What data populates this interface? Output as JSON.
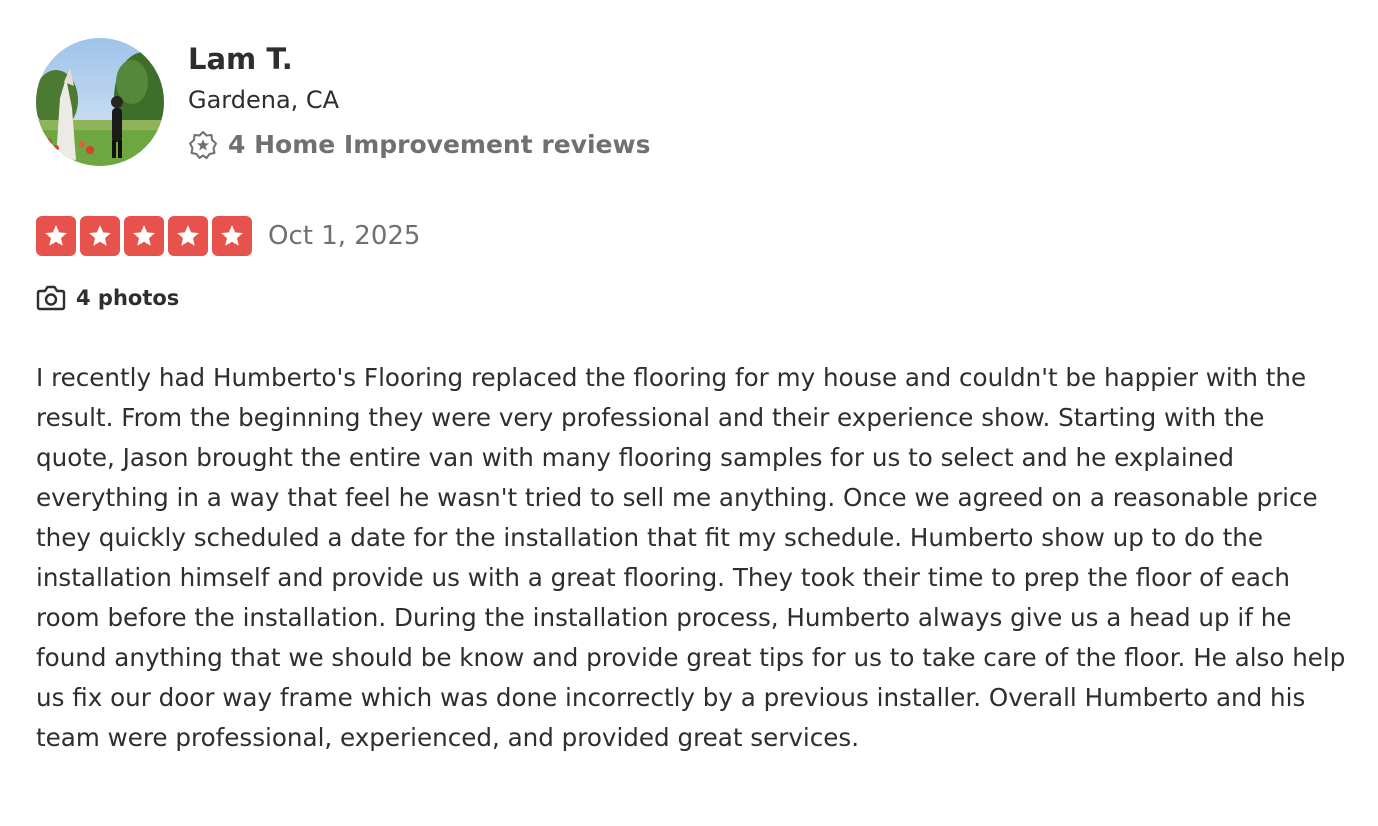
{
  "reviewer": {
    "name": "Lam T.",
    "location": "Gardena, CA",
    "review_count_label": "4 Home Improvement reviews",
    "avatar_icon": "user-photo-avatar"
  },
  "rating": {
    "stars": 5,
    "max_stars": 5,
    "star_color": "#e8524c",
    "date": "Oct 1, 2025"
  },
  "photos": {
    "label": "4 photos",
    "icon": "camera-icon"
  },
  "review": {
    "text": "I recently had Humberto's Flooring replaced the flooring for my house and couldn't be happier with the result. From the beginning they were very professional and their experience show. Starting with the quote, Jason brought the entire van with many flooring samples for us to select and he explained everything in a way that feel he wasn't tried to sell me anything. Once we agreed on a reasonable price they quickly scheduled a date for the installation that fit my schedule. Humberto show up to do the installation himself and provide us with a great flooring. They took their time to prep the floor of each room before the installation. During the installation process, Humberto always give us a head up if he found anything that we should be know and provide great tips for us to take care of the floor. He also help us fix our door way frame which was done incorrectly by a previous installer. Overall Humberto and his team were professional, experienced, and provided great services."
  }
}
